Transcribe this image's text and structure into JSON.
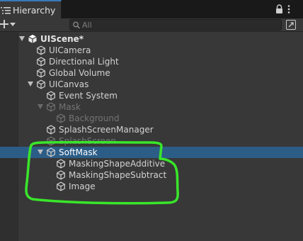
{
  "window": {
    "tab_label": "Hierarchy",
    "tab_icon": "hierarchy-list-icon"
  },
  "toolbar": {
    "add_icon": "plus-icon",
    "search_placeholder": "All",
    "search_icon": "search-icon",
    "filter_icon": "scene-filter-icon"
  },
  "hierarchy": {
    "scene": {
      "name": "UIScene*"
    },
    "items": [
      {
        "label": "UICamera",
        "depth": 1,
        "expanded": null,
        "active": true
      },
      {
        "label": "Directional Light",
        "depth": 1,
        "expanded": null,
        "active": true
      },
      {
        "label": "Global Volume",
        "depth": 1,
        "expanded": null,
        "active": true
      },
      {
        "label": "UICanvas",
        "depth": 1,
        "expanded": true,
        "active": true
      },
      {
        "label": "Event System",
        "depth": 2,
        "expanded": null,
        "active": true
      },
      {
        "label": "Mask",
        "depth": 2,
        "expanded": true,
        "active": false
      },
      {
        "label": "Background",
        "depth": 3,
        "expanded": null,
        "active": false
      },
      {
        "label": "SplashScreenManager",
        "depth": 2,
        "expanded": null,
        "active": true
      },
      {
        "label": "SplashScreen",
        "depth": 2,
        "expanded": null,
        "active": false
      },
      {
        "label": "SoftMask",
        "depth": 2,
        "expanded": true,
        "active": true,
        "selected": true
      },
      {
        "label": "MaskingShapeAdditive",
        "depth": 3,
        "expanded": null,
        "active": true
      },
      {
        "label": "MaskingShapeSubtract",
        "depth": 3,
        "expanded": null,
        "active": true
      },
      {
        "label": "Image",
        "depth": 3,
        "expanded": null,
        "active": true
      }
    ]
  },
  "colors": {
    "selection": "#2c5d87",
    "annotation_stroke": "#39e62a",
    "tab_accent": "#3a79bb"
  }
}
